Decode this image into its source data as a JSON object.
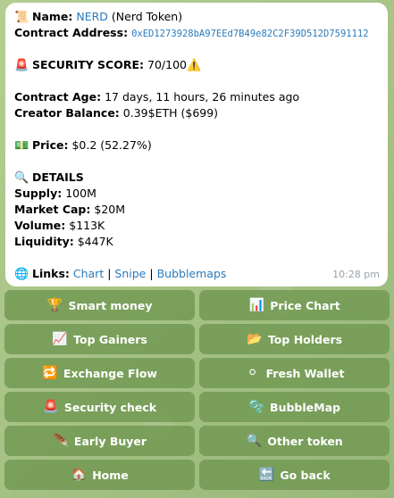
{
  "token": {
    "name_label": "Name:",
    "ticker": "NERD",
    "full_name": "(Nerd Token)",
    "contract_label": "Contract Address:",
    "contract_address": "0xED1273928bA97EEd7B49e82C2F39D512D7591112"
  },
  "security": {
    "label": "SECURITY SCORE:",
    "value": "70/100",
    "icon": "warning-icon"
  },
  "age": {
    "label": "Contract Age:",
    "value": "17 days, 11 hours, 26 minutes ago"
  },
  "creator": {
    "label": "Creator Balance:",
    "value": "0.39$ETH ($699)"
  },
  "price": {
    "label": "Price:",
    "value": "$0.2 (52.27%)"
  },
  "details": {
    "header": "DETAILS",
    "supply_label": "Supply:",
    "supply_value": "100M",
    "mcap_label": "Market Cap:",
    "mcap_value": "$20M",
    "volume_label": "Volume:",
    "volume_value": "$113K",
    "liquidity_label": "Liquidity:",
    "liquidity_value": "$447K"
  },
  "links": {
    "label": "Links:",
    "chart": "Chart",
    "snipe": "Snipe",
    "bubblemaps": "Bubblemaps",
    "separator": "|"
  },
  "message_time": "10:28 pm",
  "buttons": [
    {
      "label": "Smart money",
      "icon": "trophy-icon",
      "glyph": "🏆"
    },
    {
      "label": "Price Chart",
      "icon": "bar-chart-icon",
      "glyph": "📊"
    },
    {
      "label": "Top Gainers",
      "icon": "chart-up-icon",
      "glyph": "📈"
    },
    {
      "label": "Top Holders",
      "icon": "folder-icon",
      "glyph": "📂"
    },
    {
      "label": "Exchange Flow",
      "icon": "repeat-icon",
      "glyph": "🔁"
    },
    {
      "label": "Fresh Wallet",
      "icon": "white-circle-icon",
      "glyph": "⚪"
    },
    {
      "label": "Security check",
      "icon": "siren-icon",
      "glyph": "🚨"
    },
    {
      "label": "BubbleMap",
      "icon": "bubbles-icon",
      "glyph": "🫧"
    },
    {
      "label": "Early Buyer",
      "icon": "feather-icon",
      "glyph": "🪶"
    },
    {
      "label": "Other token",
      "icon": "magnifier-icon",
      "glyph": "🔍"
    },
    {
      "label": "Home",
      "icon": "house-icon",
      "glyph": "🏠"
    },
    {
      "label": "Go back",
      "icon": "return-icon",
      "glyph": "🔙"
    }
  ]
}
